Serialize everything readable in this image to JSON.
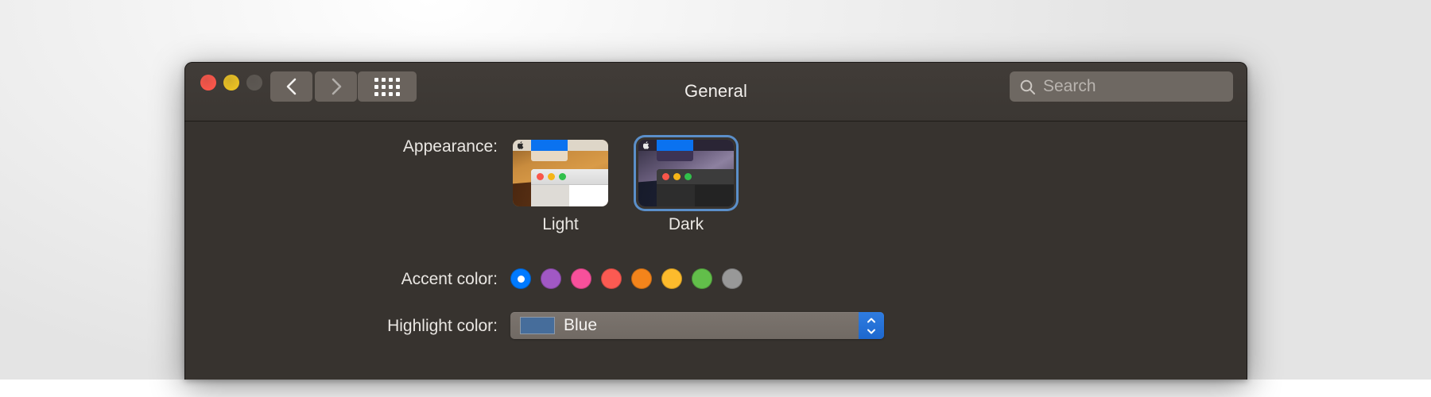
{
  "window": {
    "title": "General",
    "traffic_lights": [
      {
        "name": "close",
        "color": "#f9564a"
      },
      {
        "name": "minimize",
        "color": "#e8c024"
      },
      {
        "name": "zoom",
        "color": "#5d5853"
      }
    ],
    "toolbar": {
      "back_label": "Back",
      "forward_label": "Forward",
      "show_all_label": "Show All",
      "back_icon": "chevron-left-icon",
      "forward_icon": "chevron-right-icon",
      "grid_icon": "grid-dots-icon"
    },
    "search": {
      "placeholder": "Search",
      "value": "",
      "icon": "search-icon"
    }
  },
  "settings": {
    "appearance": {
      "label": "Appearance:",
      "selected": "Dark",
      "options": [
        {
          "id": "light",
          "label": "Light",
          "selected": false
        },
        {
          "id": "dark",
          "label": "Dark",
          "selected": true
        }
      ]
    },
    "accent_color": {
      "label": "Accent color:",
      "selected": "blue",
      "swatches": [
        {
          "id": "blue",
          "color": "#007aff",
          "selected": true
        },
        {
          "id": "purple",
          "color": "#a158c4",
          "selected": false
        },
        {
          "id": "pink",
          "color": "#f7509b",
          "selected": false
        },
        {
          "id": "red",
          "color": "#fb5a52",
          "selected": false
        },
        {
          "id": "orange",
          "color": "#f3841b",
          "selected": false
        },
        {
          "id": "yellow",
          "color": "#fdbb2c",
          "selected": false
        },
        {
          "id": "green",
          "color": "#62be4a",
          "selected": false
        },
        {
          "id": "graphite",
          "color": "#989898",
          "selected": false
        }
      ]
    },
    "highlight_color": {
      "label": "Highlight color:",
      "value": "Blue",
      "swatch_color": "#466d9b",
      "stepper_icon": "stepper-up-down-icon"
    }
  }
}
